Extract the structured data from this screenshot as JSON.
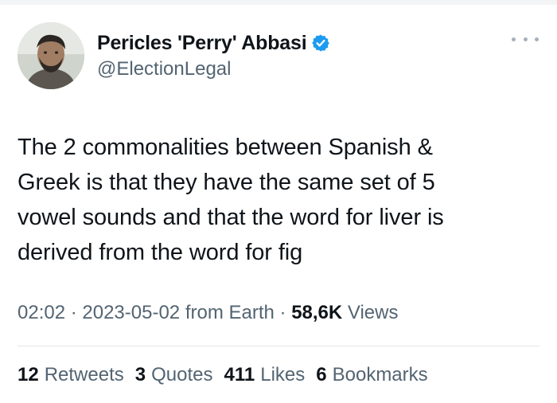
{
  "author": {
    "display_name": "Pericles 'Perry' Abbasi",
    "handle": "@ElectionLegal",
    "verified": true,
    "verified_color": "#1d9bf0"
  },
  "tweet": {
    "text": "The 2 commonalities between Spanish &\nGreek is that they have the same set of 5\nvowel sounds and that the word for liver is\nderived from the word for fig"
  },
  "meta": {
    "time": "02:02",
    "separator": " · ",
    "date": "2023-05-02",
    "source": " from Earth",
    "views_count": "58,6K",
    "views_label": " Views"
  },
  "stats": [
    {
      "count": "12",
      "label": "Retweets"
    },
    {
      "count": "3",
      "label": "Quotes"
    },
    {
      "count": "411",
      "label": "Likes"
    },
    {
      "count": "6",
      "label": "Bookmarks"
    }
  ],
  "icons": {
    "more": "more-options-icon",
    "verified": "verified-badge-icon"
  },
  "colors": {
    "text_primary": "#0f1419",
    "text_secondary": "#536471",
    "divider": "#e1e6ea"
  }
}
